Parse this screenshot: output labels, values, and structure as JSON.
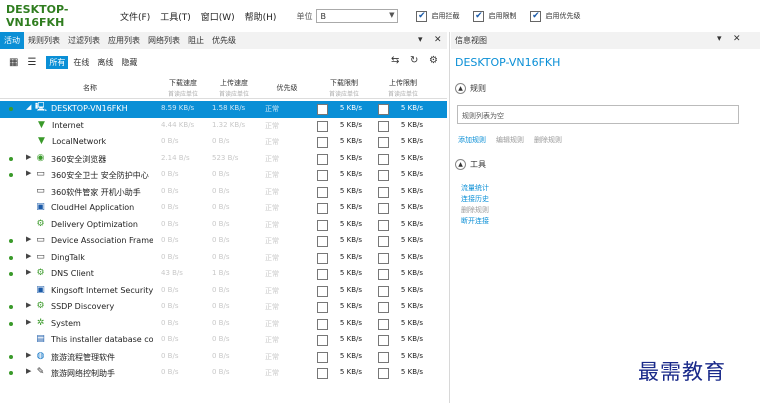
{
  "app": {
    "title": "DESKTOP-VN16FKH"
  },
  "menu": [
    "文件(F)",
    "工具(T)",
    "窗口(W)",
    "帮助(H)"
  ],
  "unit": {
    "label": "单位",
    "value": "B"
  },
  "options": [
    {
      "label": "启用拦截",
      "checked": true
    },
    {
      "label": "启用限制",
      "checked": true
    },
    {
      "label": "启用优先级",
      "checked": true
    }
  ],
  "tabs": [
    "活动",
    "规则列表",
    "过滤列表",
    "应用列表",
    "网络列表",
    "阻止",
    "优先级"
  ],
  "tab_controls": {
    "dropdown": "▾",
    "close": "✕"
  },
  "filters": [
    "所有",
    "在线",
    "离线",
    "隐藏"
  ],
  "columns": {
    "name": "名称",
    "download": {
      "title": "下载速度",
      "sub": "首读应单位"
    },
    "upload": {
      "title": "上传速度",
      "sub": "首读应单位"
    },
    "priority": "优先级",
    "dl_limit": {
      "title": "下载限制",
      "sub": "首读应单位"
    },
    "ul_limit": {
      "title": "上传限制",
      "sub": "首读应单位"
    }
  },
  "rows": [
    {
      "name": "DESKTOP-VN16FKH",
      "dl": "8.59 KB/s",
      "ul": "1.58 KB/s",
      "pr": "正常",
      "dl_limit": "5 KB/s",
      "ul_limit": "5 KB/s",
      "icon": "computer-icon",
      "indent": 0,
      "dot": true,
      "expand": "◢",
      "selected": true
    },
    {
      "name": "Internet",
      "dl": "4.44 KB/s",
      "ul": "1.32 KB/s",
      "pr": "正常",
      "dl_limit": "5 KB/s",
      "ul_limit": "5 KB/s",
      "icon": "filter-icon",
      "indent": 1,
      "dot": false,
      "expand": ""
    },
    {
      "name": "LocalNetwork",
      "dl": "0 B/s",
      "ul": "0 B/s",
      "pr": "正常",
      "dl_limit": "5 KB/s",
      "ul_limit": "5 KB/s",
      "icon": "filter-icon",
      "indent": 1,
      "dot": false,
      "expand": ""
    },
    {
      "name": "360安全浏览器",
      "dl": "2.14 B/s",
      "ul": "523 B/s",
      "pr": "正常",
      "dl_limit": "5 KB/s",
      "ul_limit": "5 KB/s",
      "icon": "browser-icon",
      "indent": 0,
      "dot": true,
      "expand": "▶"
    },
    {
      "name": "360安全卫士 安全防护中心",
      "dl": "0 B/s",
      "ul": "0 B/s",
      "pr": "正常",
      "dl_limit": "5 KB/s",
      "ul_limit": "5 KB/s",
      "icon": "window-icon",
      "indent": 0,
      "dot": true,
      "expand": "▶"
    },
    {
      "name": "360软件管家 开机小助手",
      "dl": "0 B/s",
      "ul": "0 B/s",
      "pr": "正常",
      "dl_limit": "5 KB/s",
      "ul_limit": "5 KB/s",
      "icon": "window-icon",
      "indent": 0,
      "dot": false,
      "expand": ""
    },
    {
      "name": "CloudHel Application",
      "dl": "0 B/s",
      "ul": "0 B/s",
      "pr": "正常",
      "dl_limit": "5 KB/s",
      "ul_limit": "5 KB/s",
      "icon": "app-icon",
      "indent": 0,
      "dot": false,
      "expand": ""
    },
    {
      "name": "Delivery Optimization",
      "dl": "0 B/s",
      "ul": "0 B/s",
      "pr": "正常",
      "dl_limit": "5 KB/s",
      "ul_limit": "5 KB/s",
      "icon": "gear-icon",
      "indent": 0,
      "dot": false,
      "expand": ""
    },
    {
      "name": "Device Association Frame",
      "dl": "0 B/s",
      "ul": "0 B/s",
      "pr": "正常",
      "dl_limit": "5 KB/s",
      "ul_limit": "5 KB/s",
      "icon": "window-icon",
      "indent": 0,
      "dot": true,
      "expand": "▶"
    },
    {
      "name": "DingTalk",
      "dl": "0 B/s",
      "ul": "0 B/s",
      "pr": "正常",
      "dl_limit": "5 KB/s",
      "ul_limit": "5 KB/s",
      "icon": "window-icon",
      "indent": 0,
      "dot": true,
      "expand": "▶"
    },
    {
      "name": "DNS Client",
      "dl": "43 B/s",
      "ul": "1 B/s",
      "pr": "正常",
      "dl_limit": "5 KB/s",
      "ul_limit": "5 KB/s",
      "icon": "gear-icon",
      "indent": 0,
      "dot": true,
      "expand": "▶"
    },
    {
      "name": "Kingsoft Internet Security",
      "dl": "0 B/s",
      "ul": "0 B/s",
      "pr": "正常",
      "dl_limit": "5 KB/s",
      "ul_limit": "5 KB/s",
      "icon": "app-icon",
      "indent": 0,
      "dot": false,
      "expand": ""
    },
    {
      "name": "SSDP Discovery",
      "dl": "0 B/s",
      "ul": "0 B/s",
      "pr": "正常",
      "dl_limit": "5 KB/s",
      "ul_limit": "5 KB/s",
      "icon": "gear-icon",
      "indent": 0,
      "dot": true,
      "expand": "▶"
    },
    {
      "name": "System",
      "dl": "0 B/s",
      "ul": "0 B/s",
      "pr": "正常",
      "dl_limit": "5 KB/s",
      "ul_limit": "5 KB/s",
      "icon": "system-icon",
      "indent": 0,
      "dot": true,
      "expand": "▶"
    },
    {
      "name": "This installer database co",
      "dl": "0 B/s",
      "ul": "0 B/s",
      "pr": "正常",
      "dl_limit": "5 KB/s",
      "ul_limit": "5 KB/s",
      "icon": "installer-icon",
      "indent": 0,
      "dot": false,
      "expand": ""
    },
    {
      "name": "旅游流程管理软件",
      "dl": "0 B/s",
      "ul": "0 B/s",
      "pr": "正常",
      "dl_limit": "5 KB/s",
      "ul_limit": "5 KB/s",
      "icon": "globe-icon",
      "indent": 0,
      "dot": true,
      "expand": "▶"
    },
    {
      "name": "旅游网络控制助手",
      "dl": "0 B/s",
      "ul": "0 B/s",
      "pr": "正常",
      "dl_limit": "5 KB/s",
      "ul_limit": "5 KB/s",
      "icon": "tool-icon",
      "indent": 0,
      "dot": true,
      "expand": "▶"
    }
  ],
  "right_panel": {
    "title": "信息视图",
    "heading": "DESKTOP-VN16FKH",
    "rules_section": "规则",
    "rules_empty": "规则列表为空",
    "rule_actions": [
      "添加规则",
      "编辑规则",
      "删除规则"
    ],
    "tools_section": "工具",
    "tools": [
      {
        "label": "流量统计",
        "enabled": true
      },
      {
        "label": "连接历史",
        "enabled": true
      },
      {
        "label": "删除规则",
        "enabled": false
      },
      {
        "label": "断开连接",
        "enabled": true
      }
    ]
  },
  "watermark": "最需教育",
  "colors": {
    "accent": "#0a8fd6",
    "title_green": "#2f7d1f",
    "status_dot": "#3a9a2a"
  }
}
